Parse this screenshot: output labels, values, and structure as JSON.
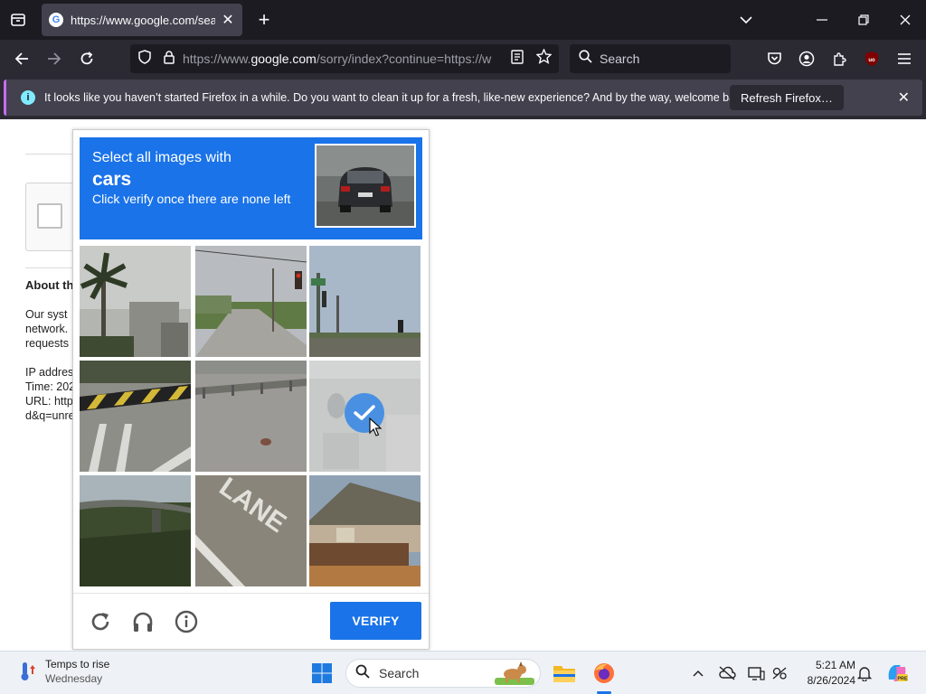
{
  "browser": {
    "tab_title": "https://www.google.com/search?",
    "favicon_letter": "G",
    "url_prefix": "https://www.",
    "url_host": "google.com",
    "url_rest": "/sorry/index?continue=https://w",
    "search_placeholder": "Search",
    "notification": {
      "message": "It looks like you haven’t started Firefox in a while. Do you want to clean it up for a fresh, like-new experience? And by the way, welcome back!",
      "button_label": "Refresh Firefox…",
      "accent_color": "#c86cf0"
    }
  },
  "page": {
    "about_heading": "About th",
    "lines": [
      "Our syst",
      "network.",
      "requests"
    ],
    "ip_line": "IP addres",
    "time_line": "Time: 202",
    "url_line": "URL: http",
    "query_line": "d&q=unre"
  },
  "captcha": {
    "instruction": "Select all images with",
    "target": "cars",
    "subtitle": "Click verify once there are none left",
    "verify_label": "VERIFY",
    "accent_color": "#1a73e8",
    "tiles": [
      {
        "name": "palm-tree-building",
        "selected": false
      },
      {
        "name": "road-traffic-light",
        "selected": false
      },
      {
        "name": "street-traffic-signals",
        "selected": false
      },
      {
        "name": "crosswalk-barrier",
        "selected": false
      },
      {
        "name": "road-guardrail",
        "selected": false
      },
      {
        "name": "faded-street",
        "selected": true
      },
      {
        "name": "overpass-bridge",
        "selected": false
      },
      {
        "name": "lane-marking",
        "selected": false
      },
      {
        "name": "house-fence",
        "selected": false
      }
    ]
  },
  "taskbar": {
    "weather_title": "Temps to rise",
    "weather_sub": "Wednesday",
    "search_label": "Search",
    "time": "5:21 AM",
    "date": "8/26/2024"
  }
}
